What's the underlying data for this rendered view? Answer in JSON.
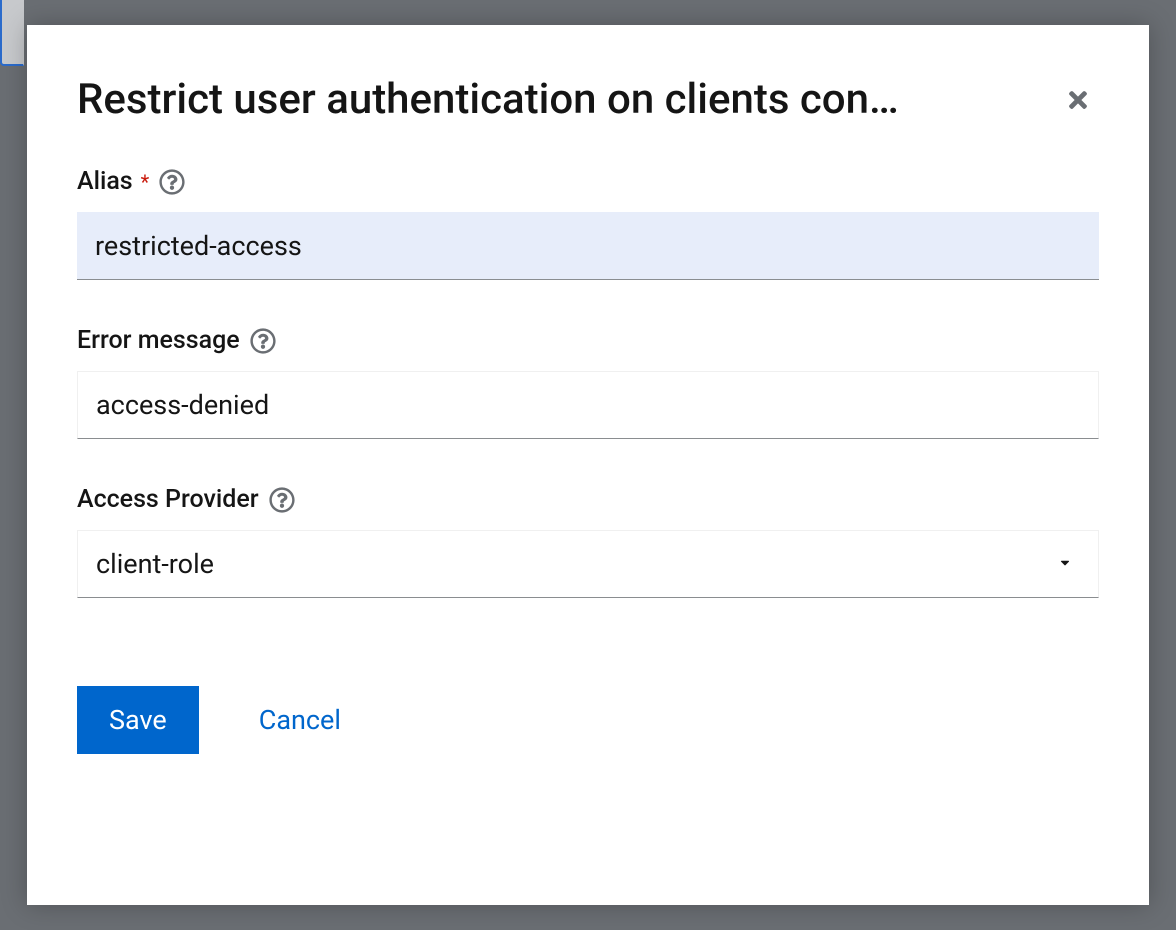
{
  "modal": {
    "title": "Restrict user authentication on clients con…",
    "fields": {
      "alias": {
        "label": "Alias",
        "required": true,
        "value": "restricted-access"
      },
      "errorMessage": {
        "label": "Error message",
        "required": false,
        "value": "access-denied"
      },
      "accessProvider": {
        "label": "Access Provider",
        "required": false,
        "value": "client-role"
      }
    },
    "buttons": {
      "save": "Save",
      "cancel": "Cancel"
    }
  }
}
